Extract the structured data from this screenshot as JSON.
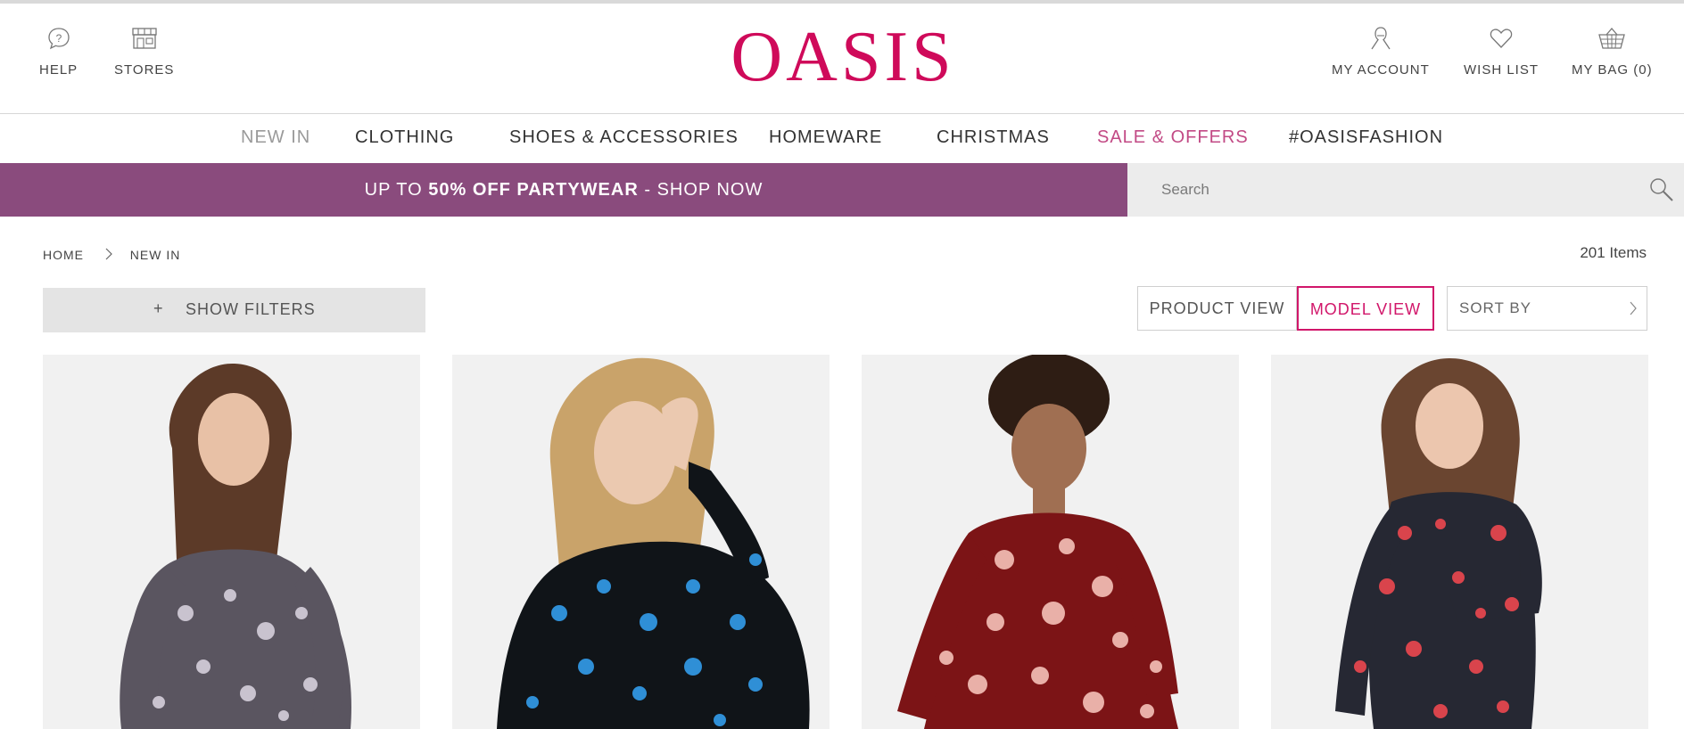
{
  "header": {
    "help_label": "HELP",
    "stores_label": "STORES",
    "logo_text": "OASIS",
    "account_label": "MY ACCOUNT",
    "wishlist_label": "WISH LIST",
    "bag_label": "MY BAG (0)"
  },
  "nav": {
    "items": [
      {
        "label": "NEW IN",
        "color": "#9a9a9a"
      },
      {
        "label": "CLOTHING",
        "color": "#333333"
      },
      {
        "label": "SHOES & ACCESSORIES",
        "color": "#333333"
      },
      {
        "label": "HOMEWARE",
        "color": "#333333"
      },
      {
        "label": "CHRISTMAS",
        "color": "#333333"
      },
      {
        "label": "SALE & OFFERS",
        "color": "#c24a85"
      },
      {
        "label": "#OASISFASHION",
        "color": "#333333"
      }
    ]
  },
  "promo": {
    "part1": "UP TO ",
    "part2": "50% OFF PARTYWEAR",
    "part3": " - SHOP NOW",
    "background": "#8a4b7d"
  },
  "search": {
    "placeholder": "Search",
    "icon": "search-icon"
  },
  "breadcrumb": {
    "home": "HOME",
    "current": "NEW IN"
  },
  "listing": {
    "item_count": "201 Items",
    "filters_label": "SHOW FILTERS",
    "filters_plus": "+",
    "product_view_label": "PRODUCT VIEW",
    "model_view_label": "MODEL VIEW",
    "sort_label": "SORT BY"
  },
  "colors": {
    "brand": "#cf0a5a",
    "active_view": "#d1166a",
    "promo": "#8a4b7d"
  },
  "products": [
    {
      "name": "grey-floral-blouse",
      "dress_color": "#5a5560",
      "pattern_color": "#c9c3cf",
      "hair_color": "#5c3a28"
    },
    {
      "name": "black-blue-floral-top",
      "dress_color": "#101418",
      "pattern_color": "#2f8fd6",
      "hair_color": "#c9a36a"
    },
    {
      "name": "red-floral-dress",
      "dress_color": "#7c1416",
      "pattern_color": "#e9b0a8",
      "hair_color": "#2e1d14"
    },
    {
      "name": "navy-floral-dress",
      "dress_color": "#262833",
      "pattern_color": "#d9444c",
      "hair_color": "#6a4530"
    }
  ]
}
